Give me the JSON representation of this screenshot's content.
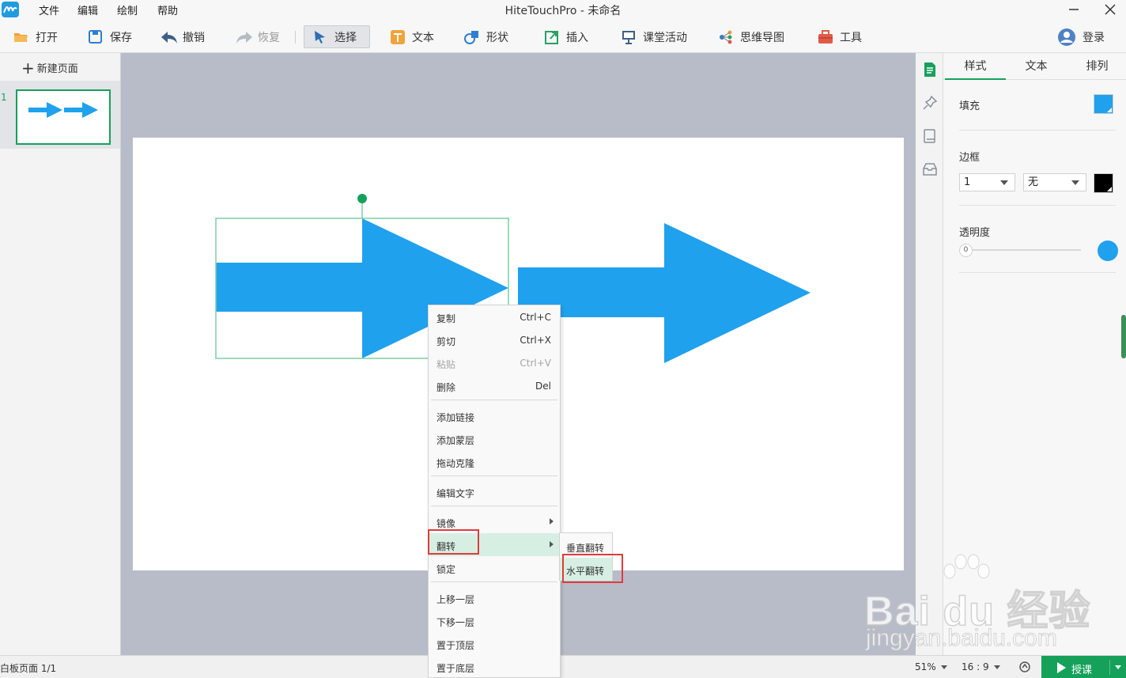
{
  "window": {
    "title": "HiteTouchPro - 未命名",
    "menu": [
      "文件",
      "编辑",
      "绘制",
      "帮助"
    ]
  },
  "toolbar": {
    "open": "打开",
    "save": "保存",
    "undo": "撤销",
    "redo": "恢复",
    "select": "选择",
    "text": "文本",
    "shape": "形状",
    "insert": "插入",
    "class_activity": "课堂活动",
    "mindmap": "思维导图",
    "tools": "工具",
    "login": "登录"
  },
  "pages": {
    "new_page": "新建页面",
    "items": [
      {
        "number": "1"
      }
    ]
  },
  "props": {
    "tabs": [
      "样式",
      "文本",
      "排列"
    ],
    "fill_label": "填充",
    "fill_color": "#1fa1ee",
    "border_label": "边框",
    "border_width": "1",
    "border_style": "无",
    "border_color": "#000000",
    "opacity_label": "透明度",
    "opacity_value": "0"
  },
  "context_menu": {
    "items": [
      {
        "label": "复制",
        "shortcut": "Ctrl+C"
      },
      {
        "label": "剪切",
        "shortcut": "Ctrl+X"
      },
      {
        "label": "粘贴",
        "shortcut": "Ctrl+V"
      },
      {
        "label": "删除",
        "shortcut": "Del"
      },
      {
        "label": "添加链接"
      },
      {
        "label": "添加蒙层"
      },
      {
        "label": "拖动克隆"
      },
      {
        "label": "编辑文字"
      },
      {
        "label": "镜像"
      },
      {
        "label": "翻转"
      },
      {
        "label": "锁定"
      },
      {
        "label": "上移一层"
      },
      {
        "label": "下移一层"
      },
      {
        "label": "置于顶层"
      },
      {
        "label": "置于底层"
      }
    ],
    "submenu": [
      "垂直翻转",
      "水平翻转"
    ]
  },
  "status": {
    "page_info": "白板页面 1/1",
    "zoom": "51%",
    "ratio": "16 : 9",
    "teach": "授课"
  },
  "colors": {
    "accent": "#16a05d",
    "shape_fill": "#1fa1ee",
    "highlight_box": "#e03b3b"
  },
  "watermark": {
    "logo": "Bai du 经验",
    "url": "jingyan.baidu.com"
  }
}
